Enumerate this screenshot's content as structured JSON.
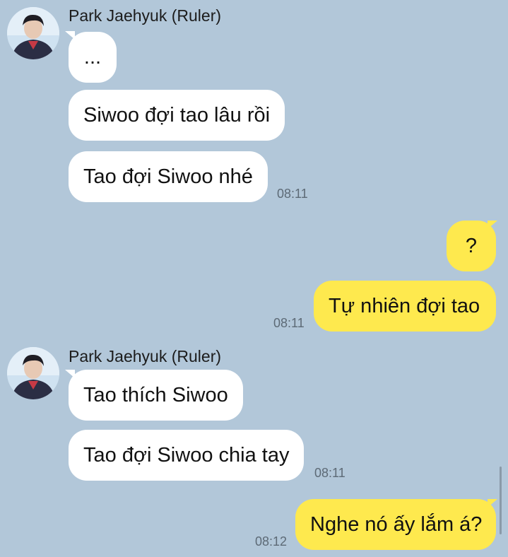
{
  "colors": {
    "background": "#b2c7d9",
    "incoming_bubble": "#ffffff",
    "outgoing_bubble": "#fee94e",
    "timestamp": "#5d6a76"
  },
  "messages": {
    "group1": {
      "sender": "Park Jaehyuk (Ruler)",
      "m1": "...",
      "m2": "Siwoo đợi tao lâu rồi",
      "m3": "Tao đợi Siwoo nhé",
      "time": "08:11"
    },
    "group2": {
      "m1": "?",
      "m2": "Tự nhiên đợi tao",
      "time": "08:11"
    },
    "group3": {
      "sender": "Park Jaehyuk (Ruler)",
      "m1": "Tao thích Siwoo",
      "m2": "Tao đợi Siwoo chia tay",
      "time": "08:11"
    },
    "group4": {
      "m1": "Nghe nó ấy lắm á?",
      "time": "08:12"
    }
  }
}
